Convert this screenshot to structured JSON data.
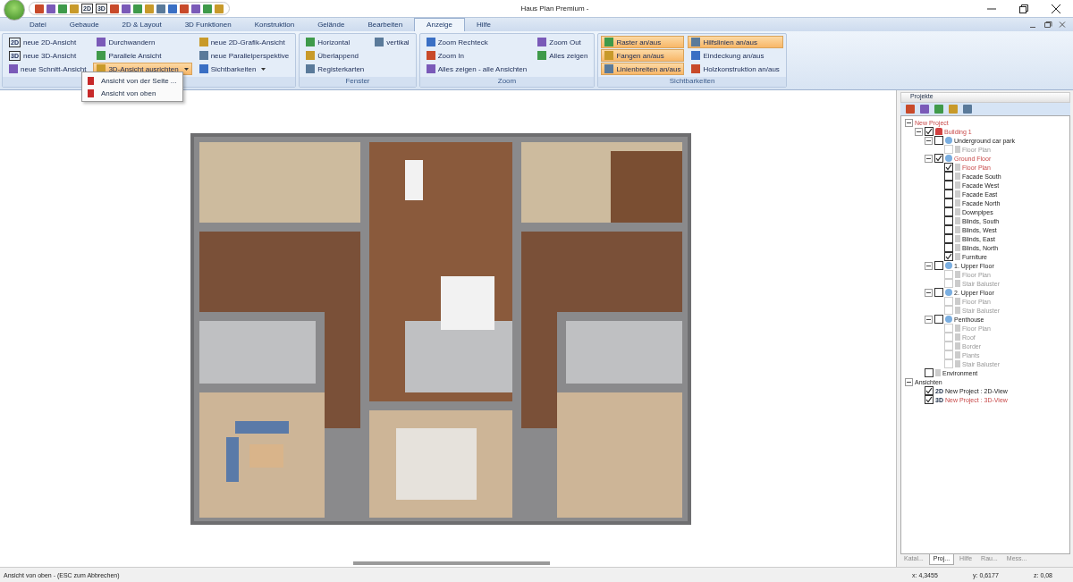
{
  "window": {
    "title": "Haus Plan Premium -"
  },
  "quick_toolbar": [
    "2D",
    "3D"
  ],
  "tabs": [
    {
      "label": "Datei",
      "selected": false
    },
    {
      "label": "Gebaude",
      "selected": false
    },
    {
      "label": "2D & Layout",
      "selected": false
    },
    {
      "label": "3D Funktionen",
      "selected": false
    },
    {
      "label": "Konstruktion",
      "selected": false
    },
    {
      "label": "Gelände",
      "selected": false
    },
    {
      "label": "Bearbeiten",
      "selected": false
    },
    {
      "label": "Anzeige",
      "selected": true
    },
    {
      "label": "Hilfe",
      "selected": false
    }
  ],
  "ribbon_groups": [
    {
      "columns": [
        [
          {
            "label": "neue 2D-Ansicht",
            "icon_text": "2D",
            "on": false,
            "dropdown": false
          },
          {
            "label": "neue 3D-Ansicht",
            "icon_text": "3D",
            "on": false,
            "dropdown": false
          },
          {
            "label": "neue Schnitt-Ansicht",
            "on": false,
            "dropdown": false
          }
        ],
        [
          {
            "label": "Durchwandern",
            "on": false,
            "dropdown": false
          },
          {
            "label": "Parallele Ansicht",
            "on": false,
            "dropdown": false
          },
          {
            "label": "3D-Ansicht ausrichten",
            "on": true,
            "dropdown": true
          }
        ],
        [
          {
            "label": "neue 2D-Grafik-Ansicht",
            "on": false,
            "dropdown": false
          },
          {
            "label": "neue Parallelperspektive",
            "on": false,
            "dropdown": false
          },
          {
            "label": "Sichtbarkeiten",
            "on": false,
            "dropdown": true
          }
        ]
      ]
    },
    {
      "title": "Fenster",
      "columns": [
        [
          {
            "label": "Horizontal",
            "on": false,
            "dropdown": false
          },
          {
            "label": "Überlappend",
            "on": false,
            "dropdown": false
          },
          {
            "label": "Registerkarten",
            "on": false,
            "dropdown": false
          }
        ],
        [
          {
            "label": "vertikal",
            "on": false,
            "dropdown": false
          }
        ]
      ]
    },
    {
      "title": "Zoom",
      "columns": [
        [
          {
            "label": "Zoom Rechteck",
            "on": false,
            "dropdown": false
          },
          {
            "label": "Zoom In",
            "on": false,
            "dropdown": false
          },
          {
            "label": "Alles zeigen - alle Ansichten",
            "on": false,
            "dropdown": false
          }
        ],
        [
          {
            "label": "Zoom Out",
            "on": false,
            "dropdown": false
          },
          {
            "label": "Alles zeigen",
            "on": false,
            "dropdown": false
          }
        ]
      ]
    },
    {
      "title": "Sichtbarkeiten",
      "columns": [
        [
          {
            "label": "Raster an/aus",
            "on": true,
            "dropdown": false
          },
          {
            "label": "Fangen an/aus",
            "on": true,
            "dropdown": false
          },
          {
            "label": "Linienbreiten an/aus",
            "on": true,
            "dropdown": false
          }
        ],
        [
          {
            "label": "Hilfslinien an/aus",
            "on": true,
            "dropdown": false
          },
          {
            "label": "Eindeckung an/aus",
            "on": false,
            "dropdown": false
          },
          {
            "label": "Holzkonstruktion an/aus",
            "on": false,
            "dropdown": false
          }
        ]
      ]
    }
  ],
  "dropdown_menu": [
    "Ansicht von der Seite ...",
    "Ansicht von oben"
  ],
  "panel": {
    "title": "Projekte",
    "tree": [
      {
        "label": "New Project",
        "active": true,
        "children": [
          {
            "label": "Building 1",
            "kind": "building",
            "checked": true,
            "active": true,
            "children": [
              {
                "label": "Underground car park",
                "kind": "floor",
                "checked": false,
                "active": false,
                "children": [
                  {
                    "label": "Floor Plan",
                    "kind": "layer",
                    "checked": false,
                    "active": false,
                    "disabled": true
                  }
                ]
              },
              {
                "label": "Ground Floor",
                "kind": "floor",
                "checked": true,
                "active": true,
                "children": [
                  {
                    "label": "Floor Plan",
                    "kind": "layer",
                    "checked": true,
                    "active": true,
                    "disabled": false
                  },
                  {
                    "label": "Facade South",
                    "kind": "layer",
                    "checked": false,
                    "active": false,
                    "disabled": false
                  },
                  {
                    "label": "Facade West",
                    "kind": "layer",
                    "checked": false,
                    "active": false,
                    "disabled": false
                  },
                  {
                    "label": "Facade East",
                    "kind": "layer",
                    "checked": false,
                    "active": false,
                    "disabled": false
                  },
                  {
                    "label": "Facade North",
                    "kind": "layer",
                    "checked": false,
                    "active": false,
                    "disabled": false
                  },
                  {
                    "label": "Downpipes",
                    "kind": "layer",
                    "checked": false,
                    "active": false,
                    "disabled": false
                  },
                  {
                    "label": "Blinds, South",
                    "kind": "layer",
                    "checked": false,
                    "active": false,
                    "disabled": false
                  },
                  {
                    "label": "Blinds, West",
                    "kind": "layer",
                    "checked": false,
                    "active": false,
                    "disabled": false
                  },
                  {
                    "label": "Blinds, East",
                    "kind": "layer",
                    "checked": false,
                    "active": false,
                    "disabled": false
                  },
                  {
                    "label": "Blinds, North",
                    "kind": "layer",
                    "checked": false,
                    "active": false,
                    "disabled": false
                  },
                  {
                    "label": "Furniture",
                    "kind": "layer",
                    "checked": true,
                    "active": false,
                    "disabled": false
                  }
                ]
              },
              {
                "label": "1. Upper Floor",
                "kind": "floor",
                "checked": false,
                "active": false,
                "children": [
                  {
                    "label": "Floor Plan",
                    "kind": "layer",
                    "checked": false,
                    "active": false,
                    "disabled": true
                  },
                  {
                    "label": "Stair Baluster",
                    "kind": "layer",
                    "checked": false,
                    "active": false,
                    "disabled": true
                  }
                ]
              },
              {
                "label": "2. Upper Floor",
                "kind": "floor",
                "checked": false,
                "active": false,
                "children": [
                  {
                    "label": "Floor Plan",
                    "kind": "layer",
                    "checked": false,
                    "active": false,
                    "disabled": true
                  },
                  {
                    "label": "Stair Baluster",
                    "kind": "layer",
                    "checked": false,
                    "active": false,
                    "disabled": true
                  }
                ]
              },
              {
                "label": "Penthouse",
                "kind": "floor",
                "checked": false,
                "active": false,
                "children": [
                  {
                    "label": "Floor Plan",
                    "kind": "layer",
                    "checked": false,
                    "active": false,
                    "disabled": true
                  },
                  {
                    "label": "Roof",
                    "kind": "layer",
                    "checked": false,
                    "active": false,
                    "disabled": true
                  },
                  {
                    "label": "Border",
                    "kind": "layer",
                    "checked": false,
                    "active": false,
                    "disabled": true
                  },
                  {
                    "label": "Plants",
                    "kind": "layer",
                    "checked": false,
                    "active": false,
                    "disabled": true
                  },
                  {
                    "label": "Stair Baluster",
                    "kind": "layer",
                    "checked": false,
                    "active": false,
                    "disabled": true
                  }
                ]
              }
            ]
          },
          {
            "label": "Environment",
            "kind": "layer",
            "checked": false,
            "active": false,
            "disabled": false
          }
        ]
      },
      {
        "label": "Ansichten",
        "active": false,
        "children": [
          {
            "label": "New Project : 2D-View",
            "kind": "view",
            "badge": "2D",
            "checked": true,
            "active": false
          },
          {
            "label": "New Project : 3D-View",
            "kind": "view",
            "badge": "3D",
            "checked": true,
            "active": true
          }
        ]
      }
    ],
    "bottom_tabs": [
      {
        "label": "Katal...",
        "selected": false
      },
      {
        "label": "Proj...",
        "selected": true
      },
      {
        "label": "Hilfe",
        "selected": false
      },
      {
        "label": "Rau...",
        "selected": false
      },
      {
        "label": "Mess...",
        "selected": false
      }
    ]
  },
  "status_bar": {
    "message": "Ansicht von oben -  (ESC zum Abbrechen)",
    "x": "x: 4,3455",
    "y": "y: 0,6177",
    "z": "z: 0,08"
  }
}
